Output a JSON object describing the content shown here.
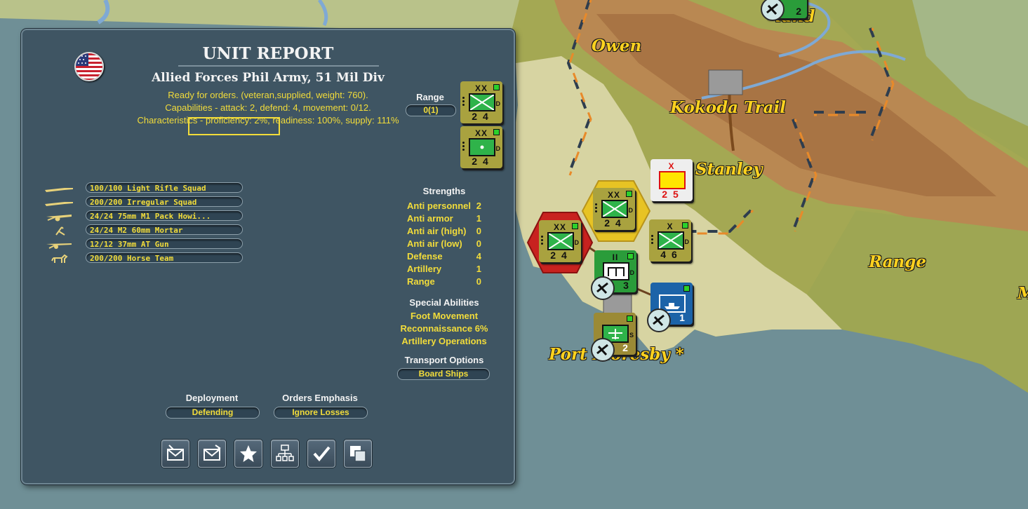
{
  "map": {
    "labels": {
      "owen": "Owen",
      "kokoda": "Kokoda Trail",
      "stanley": "Stanley",
      "range": "Range",
      "port_moresby": "Port Moresby *",
      "m": "M",
      "island_partial": "land"
    },
    "counters": [
      {
        "size": "XX",
        "attack": "2",
        "defend": "4",
        "type": "infantry"
      },
      {
        "size": "XX",
        "attack": "2",
        "defend": "4",
        "type": "infantry"
      },
      {
        "size": "X",
        "attack": "4",
        "defend": "6",
        "type": "infantry"
      },
      {
        "size": "II",
        "moves": "3",
        "type": "engineer"
      },
      {
        "size": "X",
        "attack": "2",
        "defend": "5",
        "type": "hq"
      },
      {
        "moves": "1",
        "type": "naval"
      },
      {
        "moves": "2",
        "type": "air",
        "flag": "S"
      },
      {
        "moves": "2",
        "type": "air-top"
      }
    ]
  },
  "report": {
    "title": "UNIT REPORT",
    "unit_name": "Allied Forces Phil Army, 51 Mil Div",
    "status_line": "Ready for orders. (veteran,supplied, weight: 760).",
    "capabilities_line": "Capabilities - attack: 2, defend: 4, movement: 0/12.",
    "characteristics_line": "Characteristics - proficiency: 2%, readiness: 100%, supply: 111%",
    "range_label": "Range",
    "range_value": "0(1)",
    "counter_a": {
      "size": "XX",
      "attack": "2",
      "defend": "4",
      "flag": "D"
    },
    "counter_b": {
      "size": "XX",
      "attack": "2",
      "defend": "4",
      "flag": "D"
    },
    "equipment": [
      {
        "label": "100/100 Light Rifle Squad",
        "icon": "rifle-icon"
      },
      {
        "label": "200/200 Irregular Squad",
        "icon": "rifle-icon"
      },
      {
        "label": "24/24 75mm M1 Pack Howi...",
        "icon": "howitzer-icon"
      },
      {
        "label": "24/24 M2 60mm Mortar",
        "icon": "mortar-icon"
      },
      {
        "label": "12/12 37mm AT Gun",
        "icon": "at-gun-icon"
      },
      {
        "label": "200/200 Horse Team",
        "icon": "horse-icon"
      }
    ],
    "strengths_title": "Strengths",
    "strengths": [
      {
        "label": "Anti personnel",
        "value": "2"
      },
      {
        "label": "Anti armor",
        "value": "1"
      },
      {
        "label": "Anti air (high)",
        "value": "0"
      },
      {
        "label": "Anti air (low)",
        "value": "0"
      },
      {
        "label": "Defense",
        "value": "4"
      },
      {
        "label": "Artillery",
        "value": "1"
      },
      {
        "label": "Range",
        "value": "0"
      }
    ],
    "special_title": "Special Abilities",
    "special": [
      "Foot Movement",
      "Reconnaissance  6%",
      "Artillery Operations"
    ],
    "transport_title": "Transport Options",
    "transport_value": "Board Ships",
    "deployment_title": "Deployment",
    "deployment_value": "Defending",
    "orders_title": "Orders Emphasis",
    "orders_value": "Ignore Losses",
    "buttons": [
      "mail-icon",
      "mail-send-icon",
      "star-icon",
      "org-chart-icon",
      "checkmark-icon",
      "overlap-icon"
    ]
  },
  "colors": {
    "panel": "#3f5563",
    "text_yellow": "#f2dc3a",
    "map_label": "#ffd21f",
    "counter_green": "#2fb34a",
    "counter_olive": "#a9a23f"
  }
}
